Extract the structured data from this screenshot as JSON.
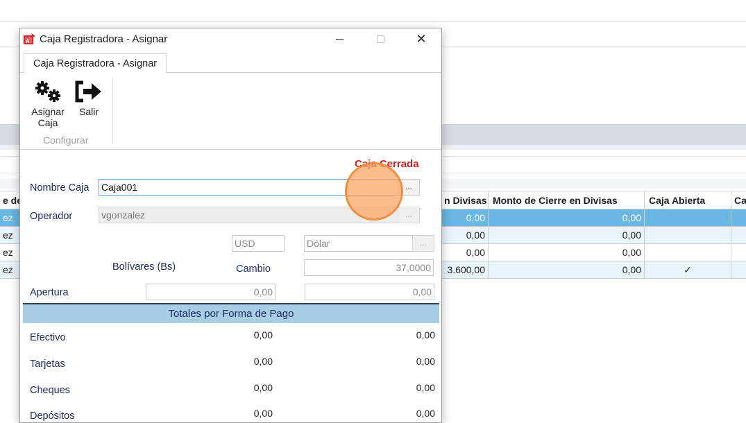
{
  "background": {
    "table": {
      "headers": [
        "e de",
        "n Divisas",
        "Monto de Cierre en Divisas",
        "Caja Abierta",
        "Ca"
      ],
      "rows": [
        {
          "c0": "ez",
          "c1": "0,00",
          "c2": "0,00",
          "c3": "",
          "selected": true
        },
        {
          "c0": "ez",
          "c1": "0,00",
          "c2": "0,00",
          "c3": ""
        },
        {
          "c0": "ez",
          "c1": "0,00",
          "c2": "0,00",
          "c3": ""
        },
        {
          "c0": "ez",
          "c1": "3.600,00",
          "c2": "0,00",
          "c3": "✓"
        }
      ]
    }
  },
  "dialog": {
    "title": "Caja Registradora -  Asignar",
    "tab_label": "Caja Registradora -  Asignar",
    "window_controls": {
      "minimize": "minimize",
      "maximize": "maximize",
      "close": "✕"
    },
    "ribbon": {
      "assign_label_1": "Asignar",
      "assign_label_2": "Caja",
      "exit_label": "Salir",
      "group_label": "Configurar"
    },
    "status": "Caja Cerrada",
    "form": {
      "nombre_caja_label": "Nombre Caja",
      "nombre_caja_value": "Caja001",
      "operador_label": "Operador",
      "operador_value": "vgonzalez",
      "ellipsis": "...",
      "currency_code": "USD",
      "currency_name": "Dólar",
      "bolivares_label": "Bolívares (Bs)",
      "cambio_label": "Cambio",
      "cambio_value": "37,0000",
      "apertura_label": "Apertura",
      "apertura_bs": "0,00",
      "apertura_div": "0,00"
    },
    "totals": {
      "header": "Totales por Forma de Pago",
      "rows": [
        {
          "label": "Efectivo",
          "bs": "0,00",
          "div": "0,00"
        },
        {
          "label": "Tarjetas",
          "bs": "0,00",
          "div": "0,00"
        },
        {
          "label": "Cheques",
          "bs": "0,00",
          "div": "0,00"
        },
        {
          "label": "Depósitos",
          "bs": "0,00",
          "div": "0,00"
        }
      ]
    }
  }
}
